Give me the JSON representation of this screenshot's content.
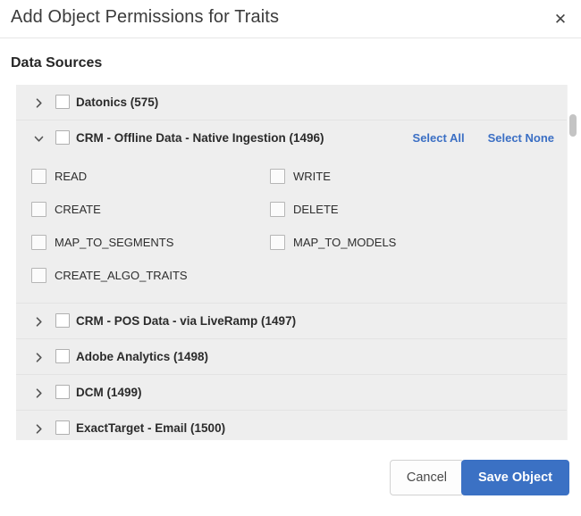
{
  "dialog": {
    "title": "Add Object Permissions for Traits",
    "close_icon": "close-icon",
    "section_title": "Data Sources"
  },
  "colors": {
    "accent": "#3b71c4",
    "link": "#3b6fc4",
    "panel_bg": "#eeeeee",
    "text": "#2c2c2c"
  },
  "links": {
    "select_all": "Select All",
    "select_none": "Select None"
  },
  "data_sources": [
    {
      "label": "Datonics (575)",
      "expanded": false,
      "chevron": "chevron-right-icon",
      "checked": false
    },
    {
      "label": "CRM - Offline Data - Native Ingestion (1496)",
      "expanded": true,
      "chevron": "chevron-down-icon",
      "checked": false,
      "permissions": [
        {
          "left": "READ",
          "right": "WRITE"
        },
        {
          "left": "CREATE",
          "right": "DELETE"
        },
        {
          "left": "MAP_TO_SEGMENTS",
          "right": "MAP_TO_MODELS"
        },
        {
          "left": "CREATE_ALGO_TRAITS",
          "right": ""
        }
      ]
    },
    {
      "label": "CRM - POS Data - via LiveRamp (1497)",
      "expanded": false,
      "chevron": "chevron-right-icon",
      "checked": false
    },
    {
      "label": "Adobe Analytics (1498)",
      "expanded": false,
      "chevron": "chevron-right-icon",
      "checked": false
    },
    {
      "label": "DCM (1499)",
      "expanded": false,
      "chevron": "chevron-right-icon",
      "checked": false
    },
    {
      "label": "ExactTarget - Email (1500)",
      "expanded": false,
      "chevron": "chevron-right-icon",
      "checked": false
    }
  ],
  "footer": {
    "cancel_label": "Cancel",
    "save_label": "Save Object"
  }
}
